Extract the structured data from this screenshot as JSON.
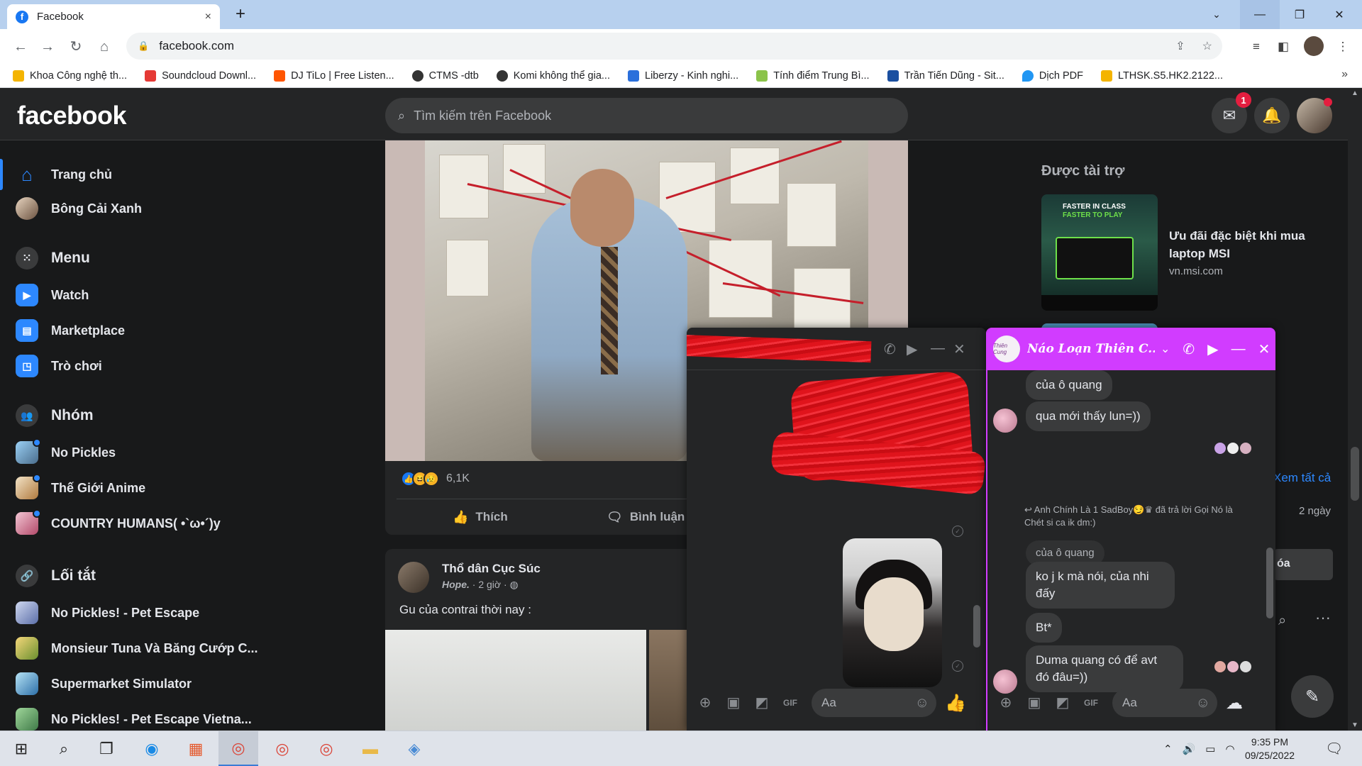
{
  "browser": {
    "tab_title": "Facebook",
    "tab_close": "×",
    "new_tab": "+",
    "url": "facebook.com",
    "bookmarks": [
      {
        "label": "Khoa Công nghệ th...",
        "color": "#f4b400"
      },
      {
        "label": "Soundcloud Downl...",
        "color": "#ff5500"
      },
      {
        "label": "DJ TiLo | Free Listen...",
        "color": "#ff5500"
      },
      {
        "label": "CTMS -dtb",
        "color": "#333333"
      },
      {
        "label": "Komi không thể gia...",
        "color": "#333333"
      },
      {
        "label": "Liberzy - Kinh nghi...",
        "color": "#2a6fdb"
      },
      {
        "label": "Tính điểm Trung Bì...",
        "color": "#8bc34a"
      },
      {
        "label": "Trần Tiến Dũng - Sit...",
        "color": "#1a4fa0"
      },
      {
        "label": "Dịch PDF",
        "color": "#2196f3"
      },
      {
        "label": "LTHSK.S5.HK2.2122...",
        "color": "#f4b400"
      }
    ],
    "more_bookmarks": "»"
  },
  "fb": {
    "logo": "facebook",
    "search_placeholder": "Tìm kiếm trên Facebook",
    "messenger_badge": "1"
  },
  "sidebar": {
    "items": [
      {
        "label": "Trang chủ",
        "icon": "home-icon"
      },
      {
        "label": "Bông Cải Xanh",
        "icon": "avatar"
      },
      {
        "label": "Menu",
        "icon": "menu-grid-icon"
      },
      {
        "label": "Watch",
        "icon": "watch-icon"
      },
      {
        "label": "Marketplace",
        "icon": "marketplace-icon"
      },
      {
        "label": "Trò chơi",
        "icon": "gaming-icon"
      },
      {
        "label": "Nhóm",
        "icon": "groups-icon"
      },
      {
        "label": "No Pickles",
        "icon": "group-avatar"
      },
      {
        "label": "Thế Giới Anime",
        "icon": "group-avatar"
      },
      {
        "label": "COUNTRY HUMANS( •`ω•´)y",
        "icon": "group-avatar"
      },
      {
        "label": "Lối tắt",
        "icon": "link-icon"
      },
      {
        "label": "No Pickles! - Pet Escape",
        "icon": "game-avatar"
      },
      {
        "label": "Monsieur Tuna Và Băng Cướp C...",
        "icon": "game-avatar"
      },
      {
        "label": "Supermarket Simulator",
        "icon": "game-avatar"
      },
      {
        "label": "No Pickles! - Pet Escape Vietna...",
        "icon": "game-avatar"
      }
    ]
  },
  "post1": {
    "reaction_count": "6,1K",
    "like_label": "Thích",
    "comment_label": "Bình luận"
  },
  "post2": {
    "author": "Thổ dân Cục Súc",
    "signature": "Hope.",
    "time": "· 2 giờ ·",
    "text": "Gu của contrai thời nay :"
  },
  "right": {
    "sponsored_title": "Được tài trợ",
    "ad_title": "Ưu đãi đặc biệt khi mua laptop MSI",
    "ad_domain": "vn.msi.com",
    "ad_img_line1": "FASTER IN CLASS",
    "ad_img_line2": "FASTER TO PLAY",
    "peek_link": "Xem tất cả",
    "peek_time": "2 ngày",
    "peek_button": "óa"
  },
  "chat1": {
    "input_placeholder": "Aa"
  },
  "chat2": {
    "name": "Náo Loạn Thiên C...",
    "avatar_text": "Thiên Cung",
    "messages": [
      "của ô quang",
      "qua mới thấy lun=))",
      "Anh Chính Là 1 SadBoy😏♛ đã trả lời Gọi Nó là Chét si ca ik dm:)",
      "của ô quang",
      "ko j k mà nói, của nhi đấy",
      "Bt*",
      "Duma quang có để avt đó đâu=))"
    ],
    "input_placeholder": "Aa"
  },
  "taskbar": {
    "time": "9:35 PM",
    "date": "09/25/2022"
  }
}
